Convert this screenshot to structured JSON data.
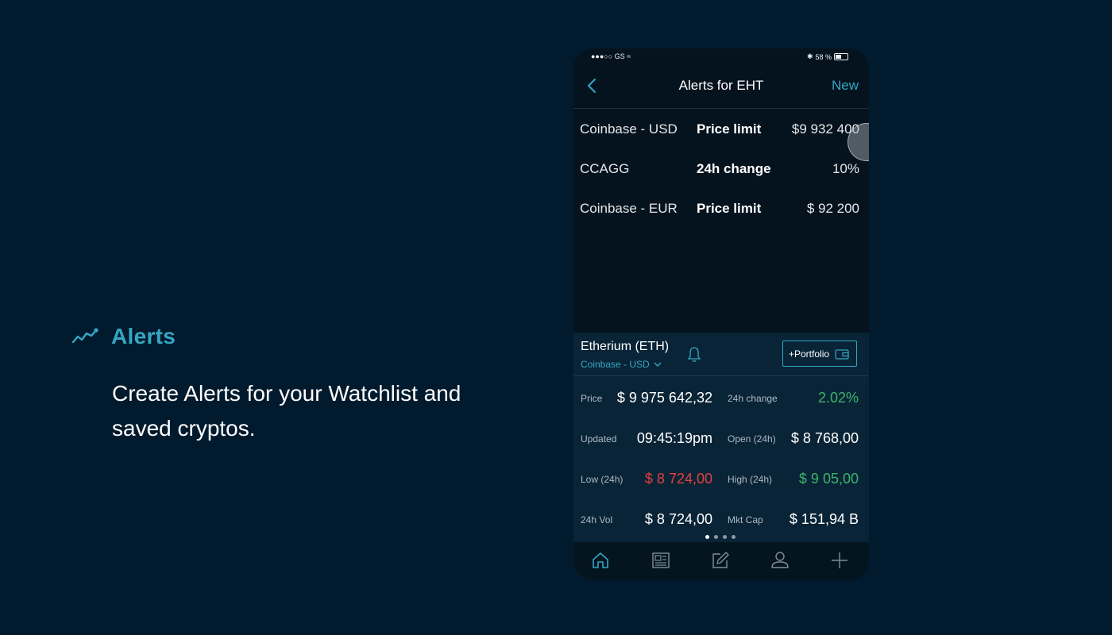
{
  "feature": {
    "title": "Alerts",
    "description": "Create Alerts for your Watchlist and saved cryptos.",
    "icon": "trend-line-icon"
  },
  "status_bar": {
    "carrier": "●●●○○ GS",
    "battery": "58 %"
  },
  "nav": {
    "title": "Alerts for EHT",
    "new_label": "New"
  },
  "alerts": [
    {
      "source": "Coinbase - USD",
      "type": "Price limit",
      "value": "$9 932 400"
    },
    {
      "source": "CCAGG",
      "type": "24h change",
      "value": "10%"
    },
    {
      "source": "Coinbase - EUR",
      "type": "Price limit",
      "value": "$ 92 200"
    }
  ],
  "coin": {
    "name": "Etherium (ETH)",
    "exchange": "Coinbase - USD",
    "portfolio_label": "+Portfolio"
  },
  "stats": {
    "price": {
      "label": "Price",
      "value": "$ 9 975 642,32"
    },
    "change": {
      "label": "24h change",
      "value": "2.02%"
    },
    "updated": {
      "label": "Updated",
      "value": "09:45:19pm"
    },
    "open": {
      "label": "Open (24h)",
      "value": "$ 8 768,00"
    },
    "low": {
      "label": "Low (24h)",
      "value": "$ 8 724,00"
    },
    "high": {
      "label": "High (24h)",
      "value": "$ 9 05,00"
    },
    "vol": {
      "label": "24h Vol",
      "value": "$ 8 724,00"
    },
    "mktcap": {
      "label": "Mkt Cap",
      "value": "$ 151,94 B"
    }
  },
  "pager": {
    "pages": 4,
    "active": 1
  },
  "colors": {
    "accent": "#35a7c4",
    "positive": "#3bb36b",
    "negative": "#e2403f",
    "background": "#021a2d"
  },
  "tabs": [
    "home-icon",
    "news-icon",
    "edit-icon",
    "profile-icon",
    "add-icon"
  ]
}
